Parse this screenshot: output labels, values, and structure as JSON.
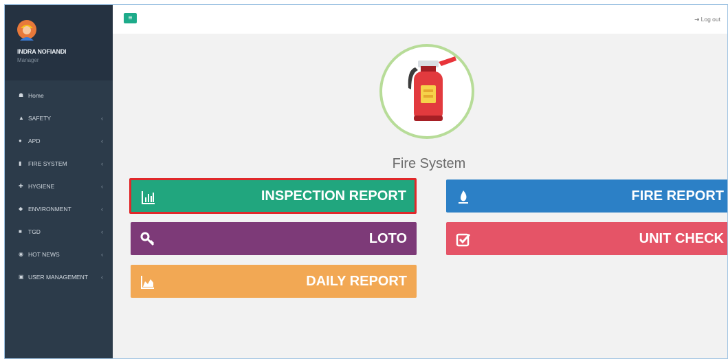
{
  "sidebar": {
    "user": {
      "name": "INDRA NOFIANDI",
      "role": "Manager"
    },
    "items": [
      {
        "label": "Home",
        "icon": "home-icon",
        "expandable": false
      },
      {
        "label": "SAFETY",
        "icon": "thumbs-up-icon",
        "expandable": true
      },
      {
        "label": "APD",
        "icon": "user-icon",
        "expandable": true
      },
      {
        "label": "FIRE SYSTEM",
        "icon": "fire-extinguisher-icon",
        "expandable": true
      },
      {
        "label": "HYGIENE",
        "icon": "plus-icon",
        "expandable": true
      },
      {
        "label": "ENVIRONMENT",
        "icon": "leaf-icon",
        "expandable": true
      },
      {
        "label": "TGD",
        "icon": "truck-icon",
        "expandable": true
      },
      {
        "label": "HOT NEWS",
        "icon": "globe-icon",
        "expandable": true
      },
      {
        "label": "USER MANAGEMENT",
        "icon": "lock-icon",
        "expandable": true
      }
    ]
  },
  "header": {
    "toggle_icon": "menu-icon",
    "logout_label": "Log out",
    "logout_icon": "sign-out-icon"
  },
  "main": {
    "title": "Fire System",
    "buttons": [
      {
        "label": "INSPECTION REPORT",
        "icon": "bar-chart-icon",
        "color": "#21a67e",
        "highlighted": true
      },
      {
        "label": "FIRE REPORT",
        "icon": "fire-icon",
        "color": "#2c80c6"
      },
      {
        "label": "LOTO",
        "icon": "key-icon",
        "color": "#7d3a78"
      },
      {
        "label": "UNIT CHECK",
        "icon": "check-square-icon",
        "color": "#e55467"
      },
      {
        "label": "DAILY REPORT",
        "icon": "area-chart-icon",
        "color": "#f2a854"
      }
    ]
  },
  "colors": {
    "sidebar": "#2c3b4a",
    "accent": "#1dab8a",
    "highlight_border": "#e0282a"
  }
}
